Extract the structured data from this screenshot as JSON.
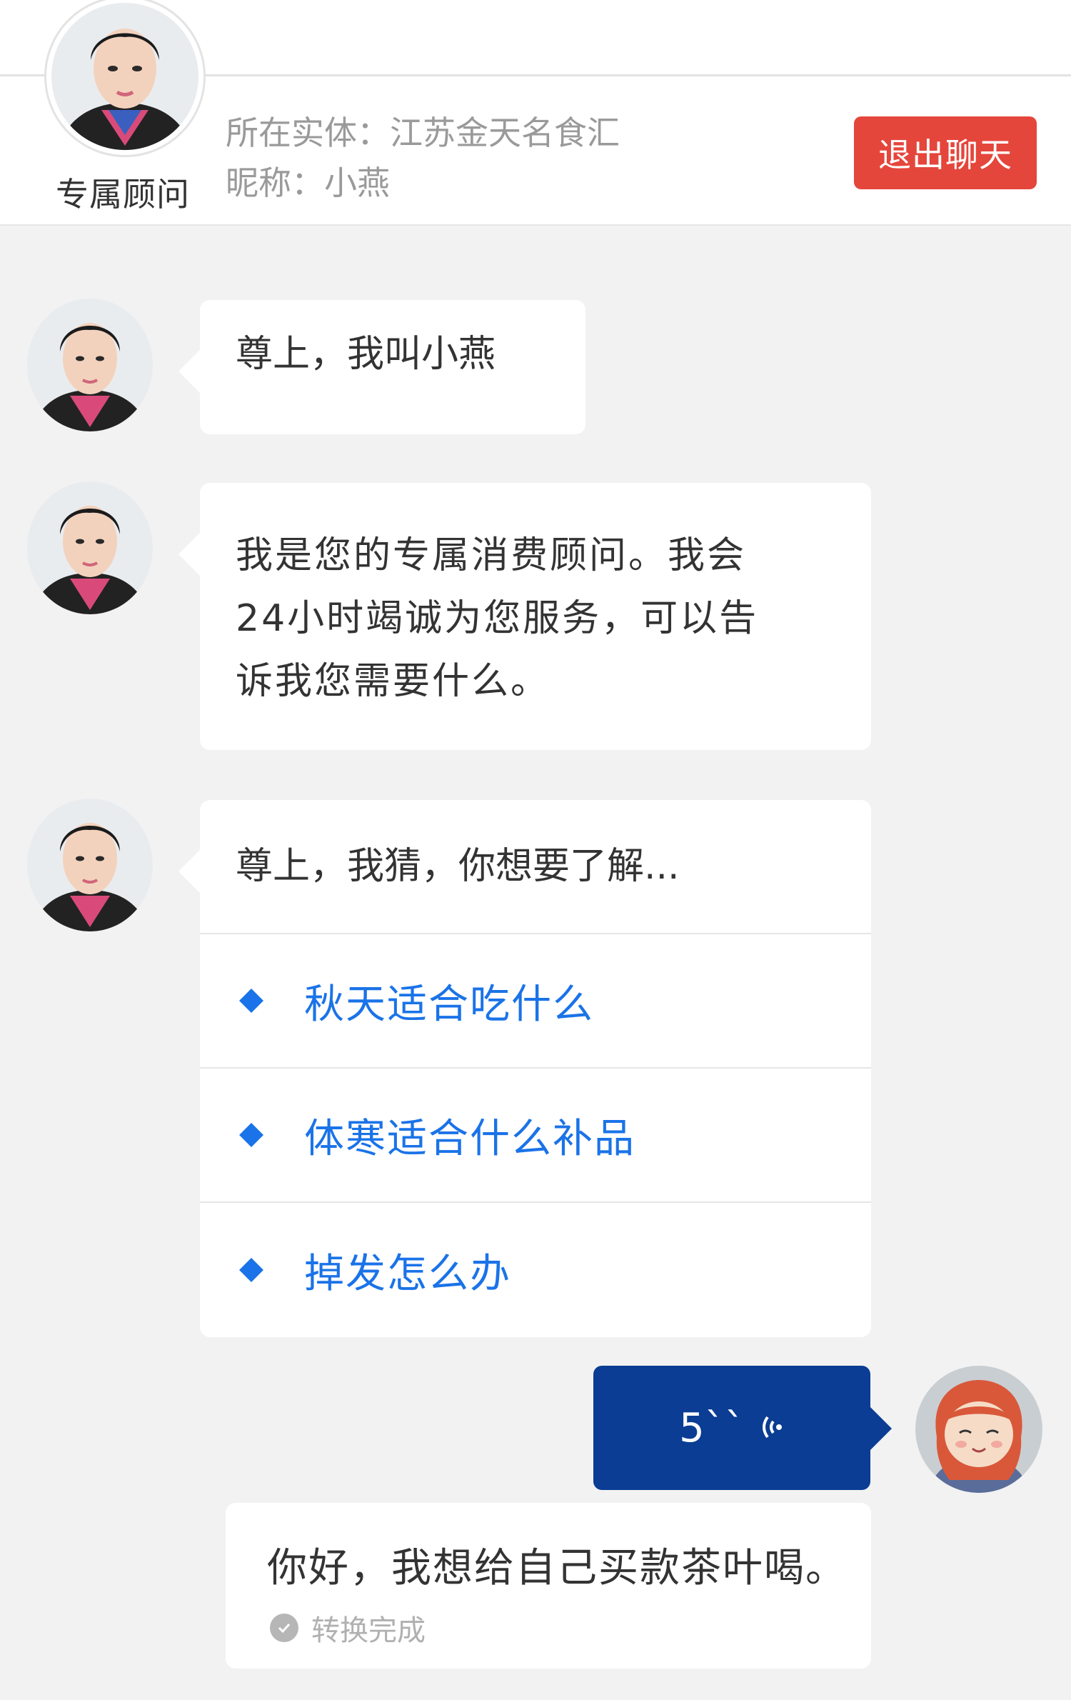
{
  "header": {
    "advisor_label": "专属顾问",
    "entity": "所在实体：江苏金天名食汇",
    "nickname": "昵称：小燕",
    "exit_button": "退出聊天"
  },
  "messages": {
    "greeting": "尊上，我叫小燕",
    "intro_lines": [
      "我是您的专属消费顾问。我会",
      "24小时竭诚为您服务，可以告",
      "诉我您需要什么。"
    ],
    "suggest_head": "尊上，我猜，你想要了解...",
    "suggestions": [
      "秋天适合吃什么",
      "体寒适合什么补品",
      "掉发怎么办"
    ]
  },
  "voice": {
    "duration": "5``",
    "transcript": "你好，我想给自己买款茶叶喝。",
    "status": "转换完成"
  },
  "colors": {
    "accent_blue": "#1a73e8",
    "voice_bg": "#0a3d93",
    "exit_red": "#e5463c"
  },
  "icons": [
    "advisor-avatar",
    "user-avatar",
    "diamond-bullet-icon",
    "sound-wave-icon",
    "check-circle-icon"
  ]
}
